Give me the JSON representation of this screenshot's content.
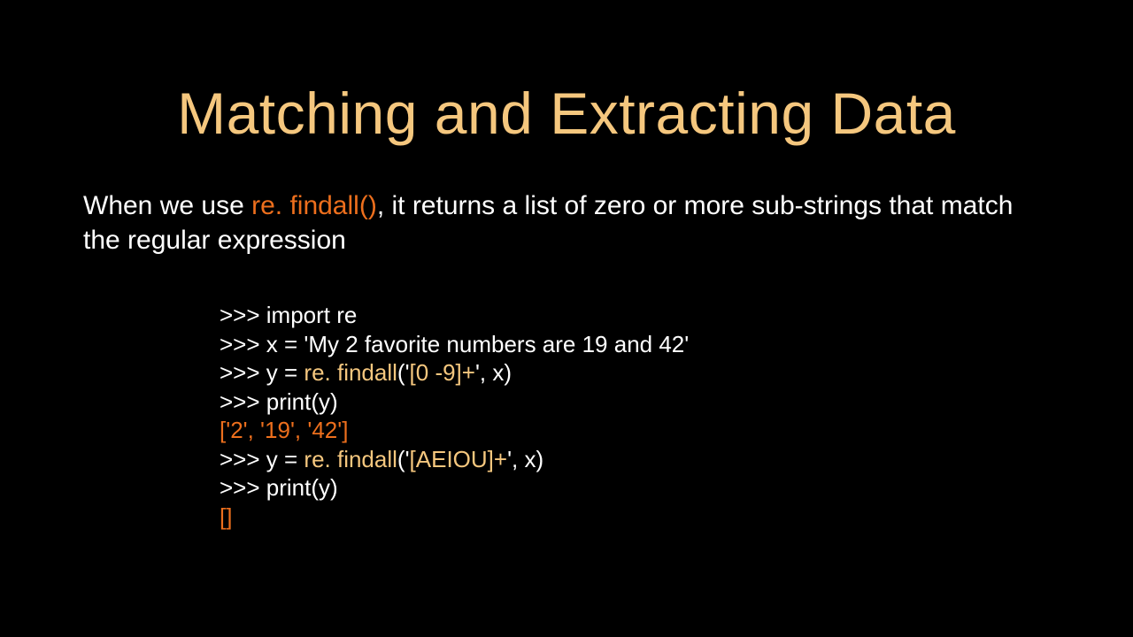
{
  "title": "Matching and Extracting Data",
  "body": {
    "t1": "When we use ",
    "t2": "re. findall()",
    "t3": ", it returns a list of zero or more sub-strings that match the regular expression"
  },
  "code": {
    "l1a": ">>> import re",
    "l2a": ">>> x = 'My 2 favorite numbers are 19 and 42'",
    "l3a": ">>> y = ",
    "l3b": "re. findall",
    "l3c": "('",
    "l3d": "[0 -9]+",
    "l3e": "', x)",
    "l4a": ">>> print(y)",
    "l5a": "['2', '19', '42']",
    "l6a": ">>> y = ",
    "l6b": "re. findall",
    "l6c": "('",
    "l6d": "[AEIOU]+",
    "l6e": "', x)",
    "l7a": ">>> print(y)",
    "l8a": "[]"
  }
}
